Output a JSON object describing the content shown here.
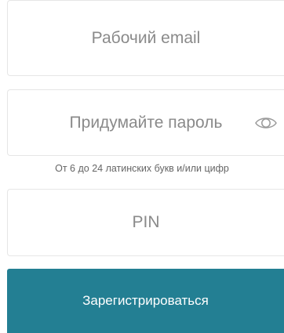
{
  "form": {
    "email": {
      "placeholder": "Рабочий email",
      "value": ""
    },
    "password": {
      "placeholder": "Придумайте пароль",
      "value": "",
      "toggle_icon": "eye-icon"
    },
    "password_hint": "От 6 до 24 латинских букв и/или цифр",
    "pin": {
      "placeholder": "PIN",
      "value": ""
    },
    "submit_label": "Зарегистрироваться"
  },
  "colors": {
    "button_bg": "#237f93",
    "button_text": "#ffffff",
    "field_border": "#e6e6e6",
    "placeholder": "#8a8a8a",
    "hint": "#666666"
  }
}
